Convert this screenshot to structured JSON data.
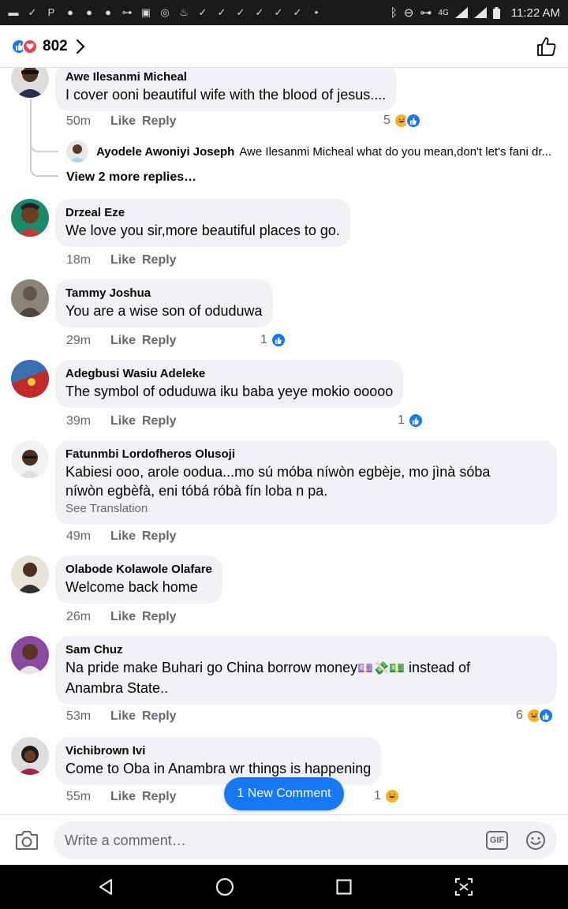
{
  "statusbar": {
    "time": "11:22 AM",
    "network": "4G"
  },
  "header": {
    "reaction_count": "802"
  },
  "comments": [
    {
      "author": "Awe Ilesanmi Micheal",
      "text": "I cover ooni beautiful wife  with the blood of jesus....",
      "time": "50m",
      "like": "Like",
      "reply": "Reply",
      "reaction_count": "5"
    },
    {
      "author": "Drzeal Eze",
      "text": "We love you sir,more beautiful places to go.",
      "time": "18m",
      "like": "Like",
      "reply": "Reply"
    },
    {
      "author": "Tammy Joshua",
      "text": "You are a wise son of oduduwa",
      "time": "29m",
      "like": "Like",
      "reply": "Reply",
      "reaction_count": "1"
    },
    {
      "author": "Adegbusi Wasiu Adeleke",
      "text": "The symbol of oduduwa iku baba yeye mokio ooooo",
      "time": "39m",
      "like": "Like",
      "reply": "Reply",
      "reaction_count": "1"
    },
    {
      "author": "Fatunmbi Lordofheros Olusoji",
      "text_line1": "Kabiesi ooo, arole oodua...mo sú móba níwòn egbèje, mo jìnà sóba",
      "text_line2": "níwòn egbèfà, eni tóbá róbà fín loba n pa.",
      "see_translation": "See Translation",
      "time": "49m",
      "like": "Like",
      "reply": "Reply"
    },
    {
      "author": "Olabode Kolawole Olafare",
      "text": "Welcome back home",
      "time": "26m",
      "like": "Like",
      "reply": "Reply"
    },
    {
      "author": "Sam Chuz",
      "text_line1": "Na pride make Buhari go China borrow money",
      "text_line1_tail": " instead of",
      "text_line2": "Anambra State..",
      "time": "53m",
      "like": "Like",
      "reply": "Reply",
      "reaction_count": "6"
    },
    {
      "author": "Vichibrown Ivi",
      "text": "Come to Oba in Anambra wr things is happening",
      "time": "55m",
      "like": "Like",
      "reply": "Reply",
      "reaction_count": "1"
    }
  ],
  "subreply": {
    "author": "Ayodele Awoniyi Joseph",
    "text": "Awe Ilesanmi Micheal what do you mean,don't let's fani dr..."
  },
  "view_more": "View 2 more replies…",
  "new_comment_pill": "1 New Comment",
  "composer": {
    "placeholder": "Write a comment…",
    "gif_label": "GIF"
  },
  "colors": {
    "accent": "#1877f2",
    "bubble": "#f0f2f5",
    "meta": "#65676b",
    "love": "#f33e58",
    "haha": "#f7b125"
  }
}
